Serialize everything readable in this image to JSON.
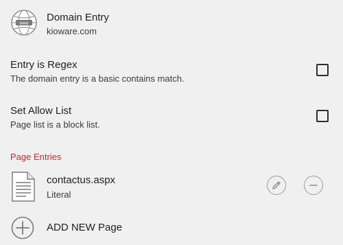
{
  "domain": {
    "title": "Domain Entry",
    "subtitle": "kioware.com",
    "icon": "globe-www-icon"
  },
  "regex": {
    "title": "Entry is Regex",
    "description": "The domain entry is a basic contains match.",
    "checked": false
  },
  "allow_list": {
    "title": "Set Allow List",
    "description": "Page list is a block list.",
    "checked": false
  },
  "page_entries": {
    "header": "Page Entries",
    "header_color": "#c0272d",
    "items": [
      {
        "name": "contactus.aspx",
        "type": "Literal",
        "icon": "document-icon"
      }
    ]
  },
  "add_new": {
    "label": "ADD NEW Page",
    "icon": "plus-circle-icon"
  }
}
